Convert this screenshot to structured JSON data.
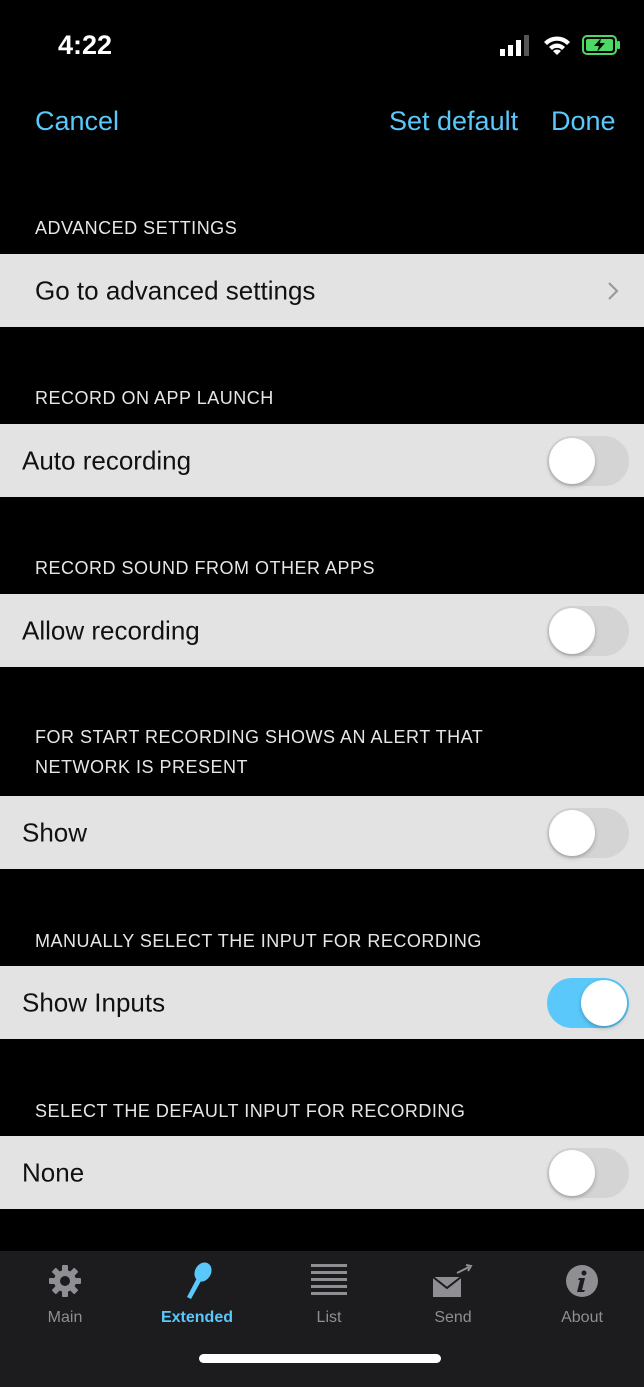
{
  "status": {
    "time": "4:22"
  },
  "navbar": {
    "cancel": "Cancel",
    "set_default": "Set default",
    "done": "Done"
  },
  "sections": [
    {
      "header": "ADVANCED SETTINGS",
      "row_label": "Go to advanced settings",
      "control": "chevron"
    },
    {
      "header": "RECORD ON APP LAUNCH",
      "row_label": "Auto recording",
      "control": "toggle",
      "on": false
    },
    {
      "header": "RECORD SOUND FROM OTHER APPS",
      "row_label": "Allow recording",
      "control": "toggle",
      "on": false
    },
    {
      "header_line1": "FOR START RECORDING SHOWS AN ALERT THAT",
      "header_line2": "NETWORK IS PRESENT",
      "row_label": "Show",
      "control": "toggle",
      "on": false
    },
    {
      "header": "MANUALLY SELECT THE INPUT FOR RECORDING",
      "row_label": "Show Inputs",
      "control": "toggle",
      "on": true
    },
    {
      "header": "SELECT THE DEFAULT INPUT FOR RECORDING",
      "row_label": "None",
      "control": "toggle",
      "on": false
    }
  ],
  "tabs": [
    {
      "label": "Main",
      "icon": "gear-icon",
      "active": false
    },
    {
      "label": "Extended",
      "icon": "microphone-icon",
      "active": true
    },
    {
      "label": "List",
      "icon": "list-icon",
      "active": false
    },
    {
      "label": "Send",
      "icon": "send-mail-icon",
      "active": false
    },
    {
      "label": "About",
      "icon": "info-icon",
      "active": false
    }
  ],
  "colors": {
    "accent": "#5ac8fa",
    "row_bg": "#e3e3e3",
    "background": "#000000",
    "tabbar_bg": "#1c1c1e",
    "toggle_off": "#d4d4d4"
  }
}
